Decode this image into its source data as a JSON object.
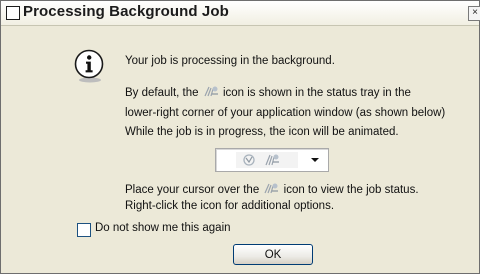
{
  "dialog": {
    "title": "Processing Background Job",
    "close_glyph": "×"
  },
  "icons": {
    "header": "info-icon",
    "inline": "background-job-icon",
    "tray": [
      "tray-icon",
      "background-job-icon"
    ],
    "dropdown": "chevron-down-icon"
  },
  "message": {
    "line1": "Your job is processing in the background.",
    "line2_prefix": "By default, the",
    "line2_suffix": "icon is shown in the status tray in the",
    "line3": "lower-right corner of your application window (as shown below)",
    "line4": "While the job is in progress, the icon will be animated.",
    "line5_prefix": "Place your cursor over the",
    "line5_suffix": "icon to view the job status.",
    "line6": "Right-click the icon for additional options."
  },
  "checkbox": {
    "label": "Do not show me this again",
    "checked": false
  },
  "buttons": {
    "ok": "OK"
  },
  "colors": {
    "dialog_background": "#ece9d8",
    "button_border": "#003c74"
  }
}
